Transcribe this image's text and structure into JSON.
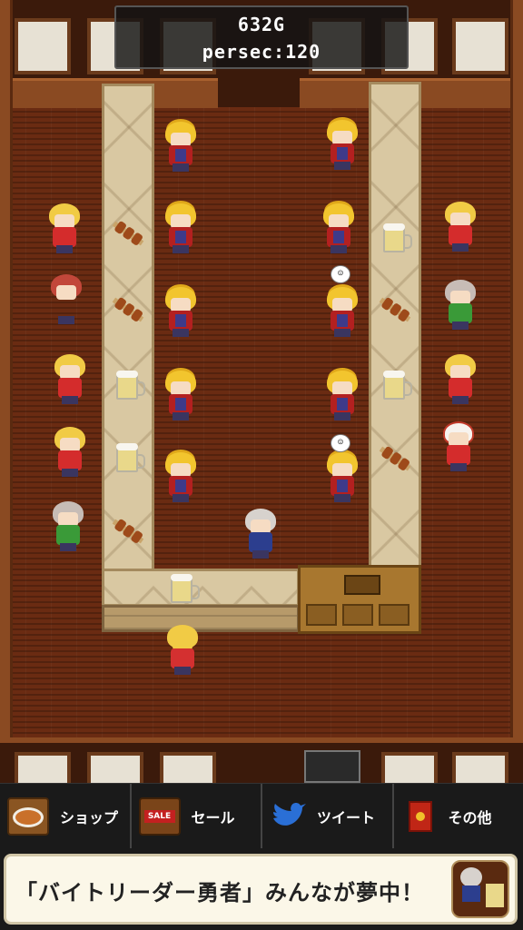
{
  "hud": {
    "gold": "632G",
    "per_sec": "persec:120"
  },
  "menu": {
    "items": [
      {
        "label": "ショップ",
        "icon": "shop-sign-icon"
      },
      {
        "label": "セール",
        "icon": "sale-sign-icon"
      },
      {
        "label": "ツイート",
        "icon": "twitter-bird-icon"
      },
      {
        "label": "その他",
        "icon": "red-book-icon"
      }
    ]
  },
  "ad": {
    "text": "「バイトリーダー勇者」みんなが夢中！"
  },
  "bubbles": {
    "b1": "☺",
    "b2": "☺"
  },
  "sale_icon_text": "SALE"
}
